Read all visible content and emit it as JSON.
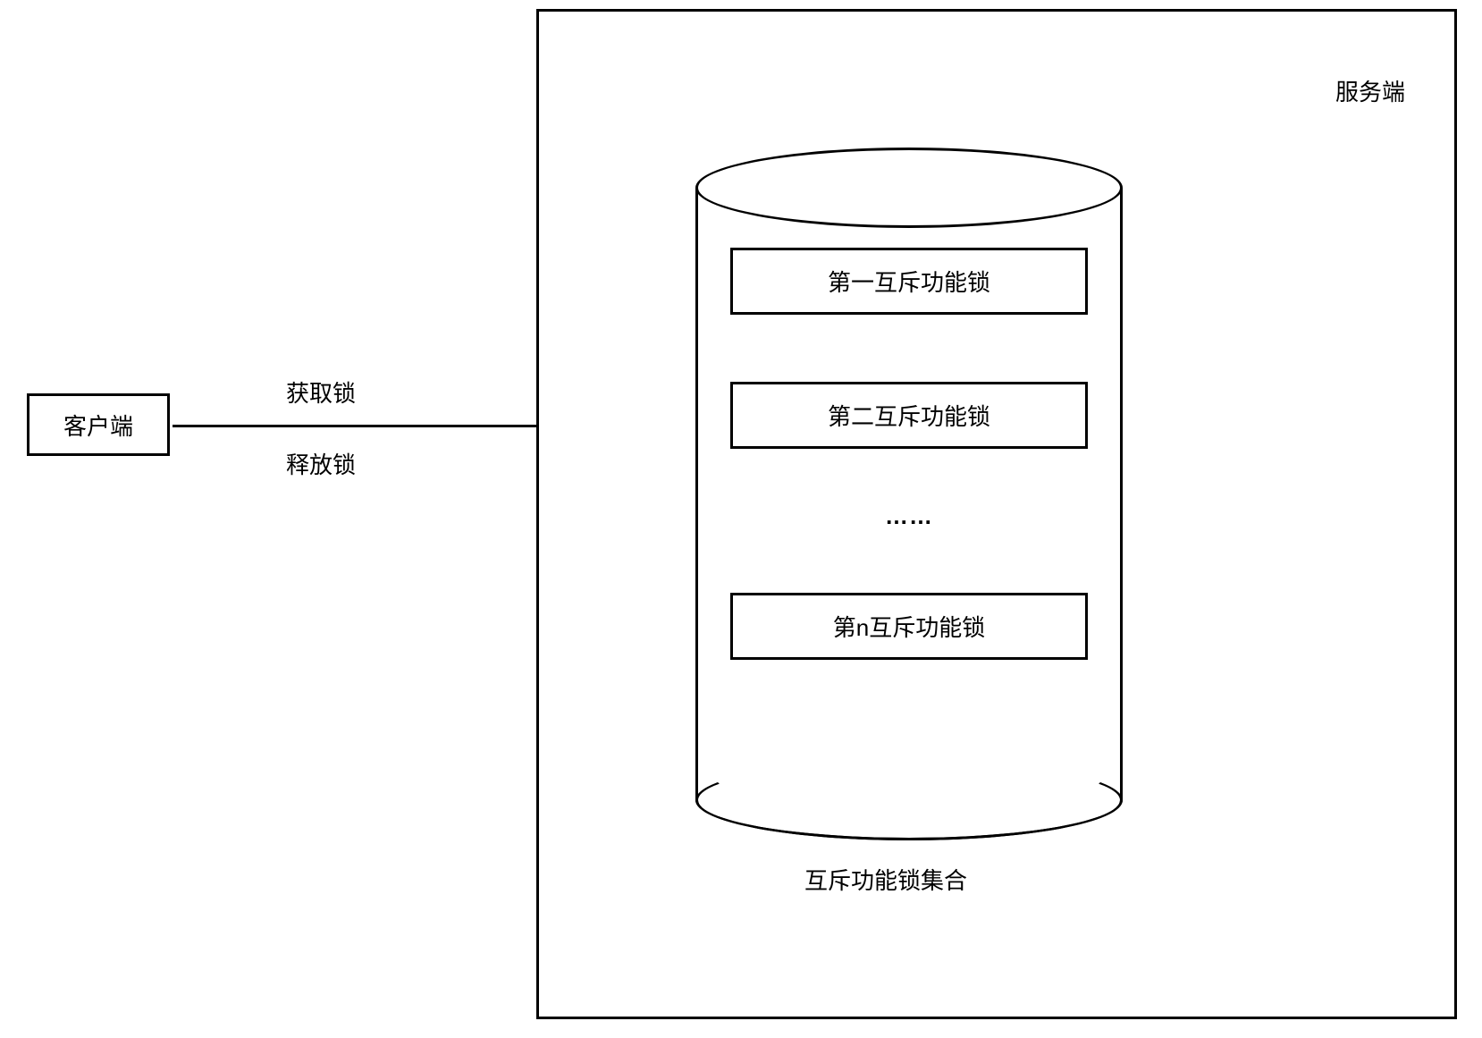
{
  "client": {
    "label": "客户端"
  },
  "server": {
    "title": "服务端"
  },
  "arrow": {
    "acquire": "获取锁",
    "release": "释放锁"
  },
  "cylinder": {
    "collection_label": "互斥功能锁集合",
    "ellipsis": "……",
    "locks": [
      {
        "label": "第一互斥功能锁"
      },
      {
        "label": "第二互斥功能锁"
      },
      {
        "label": "第n互斥功能锁"
      }
    ]
  }
}
